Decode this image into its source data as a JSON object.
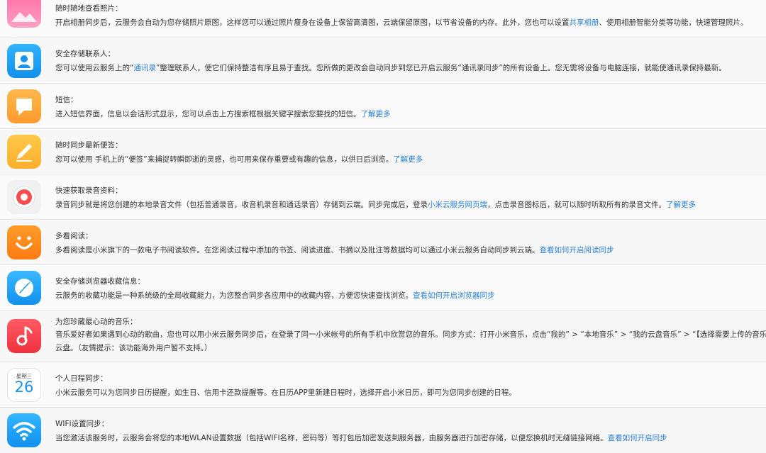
{
  "items": [
    {
      "icon": "photos-icon",
      "title": "随时随地查看照片：",
      "desc_a": "开启相册同步后，云服务会自动为您存储照片原图，这样您可以通过照片瘦身在设备上保留高清图，云端保留原图，以节省设备的内存。此外，您也可以设置",
      "link1": "共享相册",
      "desc_b": "、使用相册智能分类等功能，快速管理照片。"
    },
    {
      "icon": "contacts-icon",
      "title": "安全存储联系人：",
      "desc_a": "您可以使用云服务上的“",
      "link1": "通讯录",
      "desc_b": "”整理联系人，使它们保持整洁有序且易于查找。您所做的更改会自动同步到您已开启云服务“通讯录同步”的所有设备上。您无需将设备与电脑连接，就能使通讯录保持最新。"
    },
    {
      "icon": "sms-icon",
      "title": "短信：",
      "desc_a": "进入短信界面，信息以会话形式显示，您可以点击上方搜索框根据关键字搜索您要找的短信。",
      "link1": "了解更多"
    },
    {
      "icon": "notes-icon",
      "title": "随时同步最新便签：",
      "desc_a": "您可以使用 手机上的“便签”来捕捉转瞬即逝的灵感，也可用来保存重要或有趣的信息，以供日后浏览。",
      "link1": "了解更多"
    },
    {
      "icon": "recorder-icon",
      "title": "快速获取录音资料：",
      "desc_a": "录音同步就是将您创建的本地录音文件（包括普通录音，收音机录音和通话录音）存储到云端。同步完成后，登录",
      "link1": "小米云服务网页端",
      "desc_b": "，点击录音图标后，就可以随时听取所有的录音文件。",
      "link2": "了解更多"
    },
    {
      "icon": "reader-icon",
      "title": "多看阅读：",
      "desc_a": "多看阅读是小米旗下的一款电子书阅读软件。在您阅读过程中添加的书签、阅读进度、书摘以及批注等数据均可以通过小米云服务自动同步到云端。",
      "link1": "查看如何开启阅读同步"
    },
    {
      "icon": "browser-icon",
      "title": "安全存储浏览器收藏信息：",
      "desc_a": "云服务的收藏功能是一种系统级的全局收藏能力，为您整合同步各应用中的收藏内容，方便您快速查找浏览。",
      "link1": "查看如何开启浏览器同步"
    },
    {
      "icon": "music-icon",
      "title": "为您珍藏最心动的音乐：",
      "desc_a": "音乐爱好者如果遇到心动的歌曲，您也可以用小米云服务同步后，在登录了同一小米帐号的所有手机中欣赏您的音乐。同步方式：打开小米音乐，点击“我的” > “本地音乐” > “我的云盘音乐” > “【选择需要上传的音乐】”",
      "desc_b": "云盘。（友情提示：该功能海外用户暂不支持。）"
    },
    {
      "icon": "calendar-icon",
      "calendar_weekday": "星期三",
      "calendar_day": "26",
      "title": "个人日程同步：",
      "desc_a": "小米云服务可以为您同步日历提醒，如生日、信用卡还款提醒等。在日历APP里新建日程时，选择开启小米日历，即可为您同步创建的日程。"
    },
    {
      "icon": "wifi-icon",
      "title": "WIFI设置同步：",
      "desc_a": "当您激活该服务时，云服务会将您的本地WLAN设置数据（包括WIFI名称，密码等）等打包后加密发送到服务器，由服务器进行加密存储，以便您换机时无缝链接网络。",
      "link1": "查看如何开启同步"
    }
  ]
}
